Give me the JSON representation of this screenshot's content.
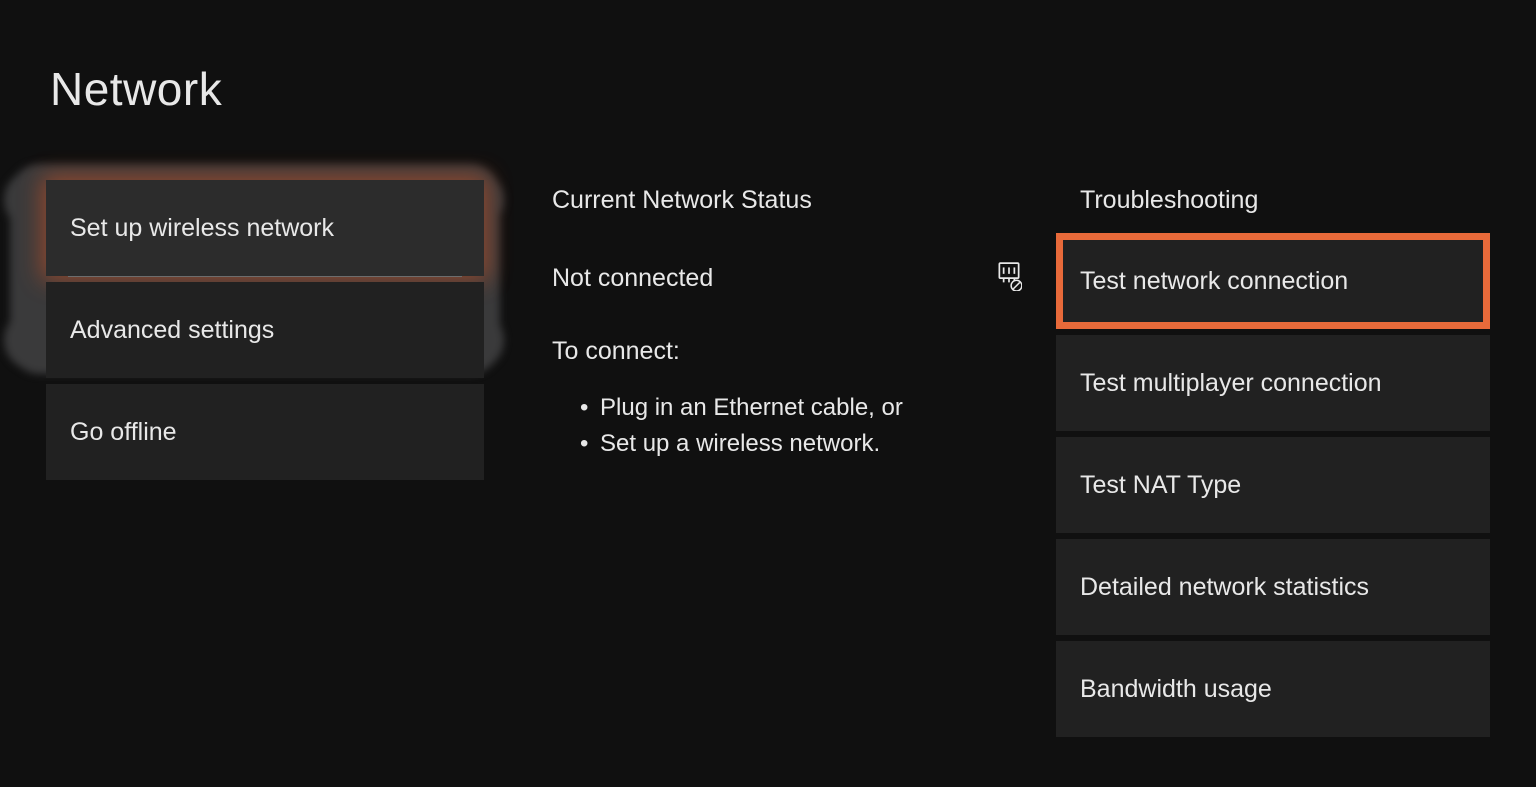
{
  "title": "Network",
  "left": {
    "setup_wireless": "Set up wireless network",
    "advanced": "Advanced settings",
    "go_offline": "Go offline"
  },
  "mid": {
    "heading": "Current Network Status",
    "status": "Not connected",
    "to_connect": "To connect:",
    "bullet1": "Plug in an Ethernet cable, or",
    "bullet2": "Set up a wireless network."
  },
  "right": {
    "heading": "Troubleshooting",
    "items": [
      "Test network connection",
      "Test multiplayer connection",
      "Test NAT Type",
      "Detailed network statistics",
      "Bandwidth usage"
    ]
  }
}
